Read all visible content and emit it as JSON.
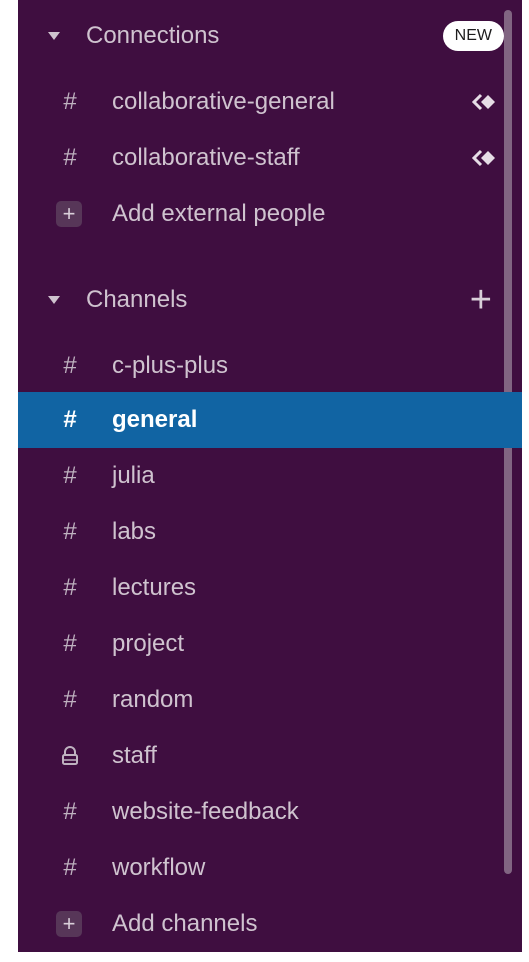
{
  "connections": {
    "title": "Connections",
    "badge": "NEW",
    "channels": [
      {
        "symbol": "#",
        "label": "collaborative-general"
      },
      {
        "symbol": "#",
        "label": "collaborative-staff"
      }
    ],
    "add_label": "Add external people"
  },
  "channels_section": {
    "title": "Channels",
    "add_symbol": "+",
    "items": [
      {
        "symbol": "#",
        "label": "c-plus-plus"
      },
      {
        "symbol": "#",
        "label": "general"
      },
      {
        "symbol": "#",
        "label": "julia"
      },
      {
        "symbol": "#",
        "label": "labs"
      },
      {
        "symbol": "#",
        "label": "lectures"
      },
      {
        "symbol": "#",
        "label": "project"
      },
      {
        "symbol": "#",
        "label": "random"
      },
      {
        "symbol": "lock",
        "label": "staff"
      },
      {
        "symbol": "#",
        "label": "website-feedback"
      },
      {
        "symbol": "#",
        "label": "workflow"
      }
    ],
    "add_label": "Add channels"
  },
  "colors": {
    "sidebar_bg": "#3f0e40",
    "active_bg": "#1164a3",
    "text": "#cfc3cf"
  }
}
